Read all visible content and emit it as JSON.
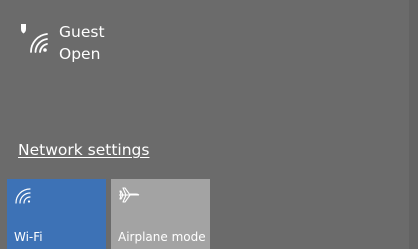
{
  "network": {
    "name": "Guest",
    "status": "Open",
    "icon": "wifi-secured-warning-icon"
  },
  "settings_link": {
    "label": "Network settings"
  },
  "quick_actions": [
    {
      "label": "Wi-Fi",
      "icon": "wifi-icon",
      "active": true,
      "color": "#3d72b6"
    },
    {
      "label": "Airplane mode",
      "icon": "airplane-icon",
      "active": false,
      "color": "#a3a3a3"
    }
  ],
  "colors": {
    "background": "#6b6b6b",
    "accent": "#3d72b6",
    "text": "#ffffff"
  }
}
